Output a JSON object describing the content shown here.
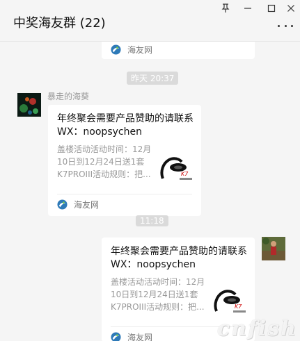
{
  "window": {
    "title": "中奖海友群 (22)",
    "buttons": [
      "pin-icon",
      "minimize-icon",
      "maximize-icon",
      "close-icon"
    ]
  },
  "messages": {
    "prev_source": "海友网",
    "timestamp_1": "昨天 20:37",
    "timestamp_2": "11:18",
    "incoming": {
      "sender": "暴走的海葵",
      "card_title": "年终聚会需要产品赞助的请联系WX：noopsychen",
      "card_desc": "盖楼活动活动时间：12月10日到12月24日送1套K7PROIII活动规则：把...",
      "source": "海友网"
    },
    "outgoing": {
      "card_title": "年终聚会需要产品赞助的请联系WX：noopsychen",
      "card_desc": "盖楼活动活动时间：12月10日到12月24日送1套K7PROIII活动规则：把...",
      "source": "海友网"
    }
  },
  "watermark": "cnfish",
  "colors": {
    "background": "#f5f5f5",
    "card": "#ffffff",
    "timestamp_bg": "#dadada",
    "muted_text": "#999999"
  }
}
